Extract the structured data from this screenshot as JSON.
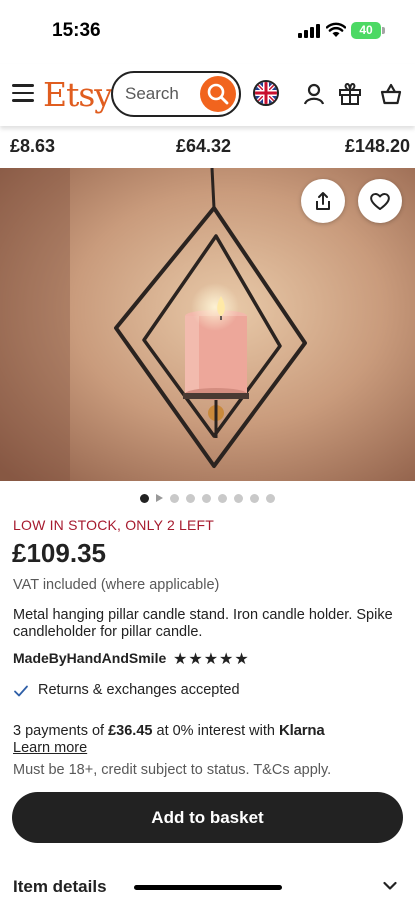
{
  "status_bar": {
    "time": "15:36",
    "battery": "40"
  },
  "header": {
    "logo": "Etsy",
    "search_placeholder": "Search"
  },
  "prices_row": [
    "£8.63",
    "£64.32",
    "£148.20"
  ],
  "gallery": {
    "image_count": 9,
    "active_index": 0
  },
  "product": {
    "stock_notice": "LOW IN STOCK, ONLY 2 LEFT",
    "price": "£109.35",
    "vat_note": "VAT included (where applicable)",
    "title": "Metal hanging pillar candle stand. Iron candle holder. Spike candleholder for pillar candle.",
    "shop_name": "MadeByHandAndSmile",
    "rating_stars": "★★★★★",
    "returns": "Returns & exchanges accepted",
    "klarna": {
      "prefix": "3 payments of",
      "amount": "£36.45",
      "suffix": "at 0% interest with",
      "brand": "Klarna",
      "learn_more": "Learn more",
      "disclaimer": "Must be 18+, credit subject to status. T&Cs apply."
    },
    "add_to_basket": "Add to basket",
    "item_details": "Item details"
  },
  "colors": {
    "brand": "#f1641e",
    "stock": "#a61a2e",
    "button": "#222222"
  }
}
